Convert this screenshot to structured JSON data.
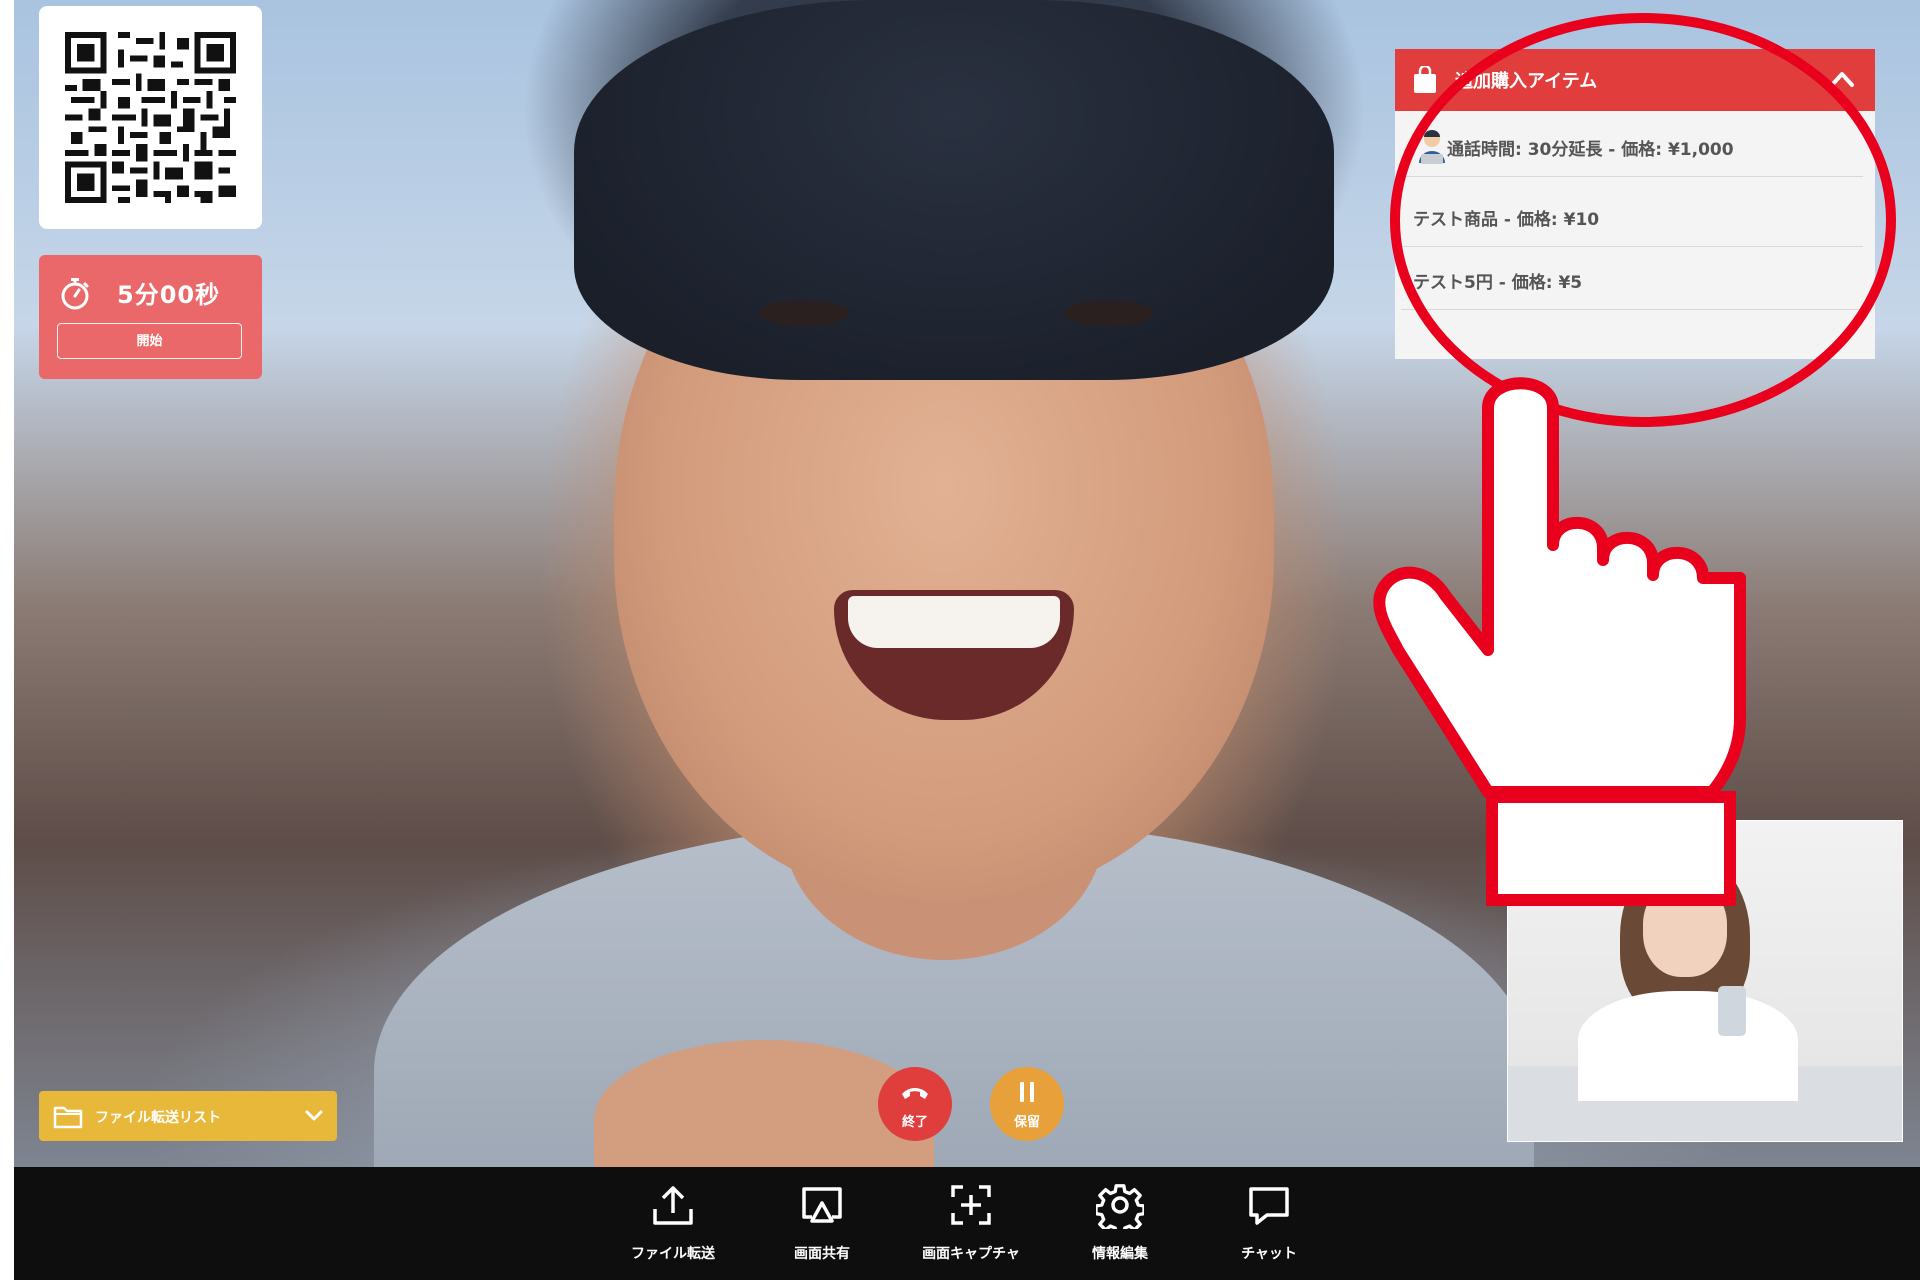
{
  "timer": {
    "time": "5分00秒",
    "start_label": "開始"
  },
  "items_panel": {
    "title": "追加購入アイテム",
    "items": [
      {
        "label": "通話時間: 30分延長 - 価格: ¥1,000"
      },
      {
        "label": "テスト商品 - 価格: ¥10"
      },
      {
        "label": "テスト5円 - 価格: ¥5"
      }
    ]
  },
  "file_list": {
    "label": "ファイル転送リスト"
  },
  "call": {
    "end_label": "終了",
    "hold_label": "保留"
  },
  "toolbar": {
    "items": [
      {
        "label": "ファイル転送",
        "icon": "upload-icon"
      },
      {
        "label": "画面共有",
        "icon": "screen-share-icon"
      },
      {
        "label": "画面キャプチャ",
        "icon": "screen-capture-icon"
      },
      {
        "label": "情報編集",
        "icon": "gear-icon"
      },
      {
        "label": "チャット",
        "icon": "chat-icon"
      }
    ]
  },
  "colors": {
    "timer_bg": "#ea6869",
    "panel_header": "#e23d3d",
    "file_list_bg": "#e8b83a",
    "end_button": "#e03d3d",
    "hold_button": "#e8a03a",
    "toolbar_bg": "#0e0e0e",
    "callout_red": "#e8001c"
  }
}
